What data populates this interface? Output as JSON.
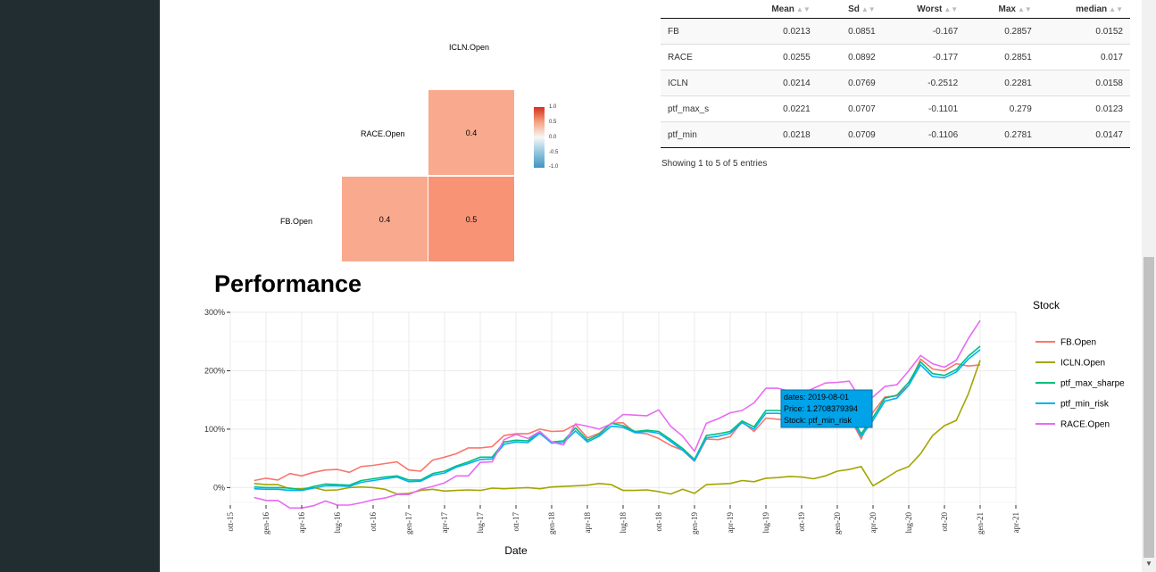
{
  "correlation": {
    "row_labels": [
      "ICLN.Open",
      "RACE.Open",
      "FB.Open"
    ],
    "cells": [
      {
        "row": "RACE.Open",
        "col": "ICLN.Open",
        "value": "0.4",
        "color": "#f9a98e"
      },
      {
        "row": "FB.Open",
        "col": "RACE.Open",
        "value": "0.4",
        "color": "#f9a98e"
      },
      {
        "row": "FB.Open",
        "col": "ICLN.Open",
        "value": "0.5",
        "color": "#f99376"
      }
    ],
    "legend_ticks": [
      "1.0",
      "0.5",
      "0.0",
      "-0.5",
      "-1.0"
    ]
  },
  "stats_table": {
    "headers": [
      "",
      "Mean",
      "Sd",
      "Worst",
      "Max",
      "median"
    ],
    "rows": [
      [
        "FB",
        "0.0213",
        "0.0851",
        "-0.167",
        "0.2857",
        "0.0152"
      ],
      [
        "RACE",
        "0.0255",
        "0.0892",
        "-0.177",
        "0.2851",
        "0.017"
      ],
      [
        "ICLN",
        "0.0214",
        "0.0769",
        "-0.2512",
        "0.2281",
        "0.0158"
      ],
      [
        "ptf_max_s",
        "0.0221",
        "0.0707",
        "-0.1101",
        "0.279",
        "0.0123"
      ],
      [
        "ptf_min",
        "0.0218",
        "0.0709",
        "-0.1106",
        "0.2781",
        "0.0147"
      ]
    ],
    "info": "Showing 1 to 5 of 5 entries"
  },
  "performance": {
    "title": "Performance",
    "tooltip": {
      "line1": "dates: 2019-08-01",
      "line2": "Price:  1.2708379394",
      "line3": "Stock: ptf_min_risk"
    }
  },
  "chart_data": {
    "type": "line",
    "xlabel": "Date",
    "ylabel": "",
    "legend_title": "Stock",
    "ylim": [
      -0.3,
      3.0
    ],
    "yticks": [
      "300%",
      "200%",
      "100%",
      "0%"
    ],
    "xticks": [
      "ott-15",
      "gen-16",
      "apr-16",
      "lug-16",
      "ott-16",
      "gen-17",
      "apr-17",
      "lug-17",
      "ott-17",
      "gen-18",
      "apr-18",
      "lug-18",
      "ott-18",
      "gen-19",
      "apr-19",
      "lug-19",
      "ott-19",
      "gen-20",
      "apr-20",
      "lug-20",
      "ott-20",
      "gen-21",
      "apr-21"
    ],
    "x": [
      "2015-12",
      "2016-01",
      "2016-02",
      "2016-03",
      "2016-04",
      "2016-05",
      "2016-06",
      "2016-07",
      "2016-08",
      "2016-09",
      "2016-10",
      "2016-11",
      "2016-12",
      "2017-01",
      "2017-02",
      "2017-03",
      "2017-04",
      "2017-05",
      "2017-06",
      "2017-07",
      "2017-08",
      "2017-09",
      "2017-10",
      "2017-11",
      "2017-12",
      "2018-01",
      "2018-02",
      "2018-03",
      "2018-04",
      "2018-05",
      "2018-06",
      "2018-07",
      "2018-08",
      "2018-09",
      "2018-10",
      "2018-11",
      "2018-12",
      "2019-01",
      "2019-02",
      "2019-03",
      "2019-04",
      "2019-05",
      "2019-06",
      "2019-07",
      "2019-08",
      "2019-09",
      "2019-10",
      "2019-11",
      "2019-12",
      "2020-01",
      "2020-02",
      "2020-03",
      "2020-04",
      "2020-05",
      "2020-06",
      "2020-07",
      "2020-08",
      "2020-09",
      "2020-10",
      "2020-11",
      "2020-12",
      "2021-01"
    ],
    "series": [
      {
        "name": "FB.Open",
        "color": "#f8766d",
        "values": [
          0.12,
          0.16,
          0.13,
          0.24,
          0.2,
          0.26,
          0.3,
          0.31,
          0.26,
          0.36,
          0.38,
          0.41,
          0.44,
          0.3,
          0.28,
          0.47,
          0.52,
          0.58,
          0.68,
          0.68,
          0.7,
          0.89,
          0.92,
          0.92,
          1.0,
          0.96,
          0.97,
          1.08,
          0.85,
          0.93,
          1.1,
          1.11,
          0.94,
          0.92,
          0.84,
          0.72,
          0.64,
          0.45,
          0.83,
          0.82,
          0.87,
          1.13,
          0.96,
          1.19,
          1.17,
          1.15,
          1.13,
          1.18,
          1.34,
          1.43,
          1.22,
          0.83,
          1.29,
          1.55,
          1.57,
          1.75,
          2.2,
          2.03,
          2.0,
          2.12,
          2.08,
          2.1
        ]
      },
      {
        "name": "ICLN.Open",
        "color": "#a3a500",
        "values": [
          0.07,
          0.05,
          0.05,
          -0.02,
          -0.02,
          0.0,
          -0.05,
          -0.04,
          0.0,
          0.01,
          0.0,
          -0.03,
          -0.11,
          -0.1,
          -0.05,
          -0.03,
          -0.06,
          -0.05,
          -0.04,
          -0.05,
          -0.01,
          -0.02,
          -0.01,
          0.0,
          -0.02,
          0.01,
          0.02,
          0.03,
          0.04,
          0.07,
          0.05,
          -0.05,
          -0.05,
          -0.04,
          -0.07,
          -0.11,
          -0.03,
          -0.1,
          0.05,
          0.06,
          0.07,
          0.12,
          0.1,
          0.16,
          0.17,
          0.19,
          0.18,
          0.15,
          0.2,
          0.28,
          0.31,
          0.36,
          0.03,
          0.15,
          0.28,
          0.36,
          0.58,
          0.89,
          1.06,
          1.15,
          1.6,
          2.18
        ]
      },
      {
        "name": "ptf_max_sharpe",
        "color": "#00bf7d",
        "values": [
          0.01,
          0.0,
          0.0,
          -0.01,
          -0.04,
          0.02,
          0.06,
          0.05,
          0.04,
          0.12,
          0.15,
          0.18,
          0.2,
          0.13,
          0.13,
          0.24,
          0.28,
          0.37,
          0.44,
          0.52,
          0.52,
          0.78,
          0.81,
          0.8,
          0.96,
          0.78,
          0.8,
          1.02,
          0.81,
          0.91,
          1.1,
          1.06,
          0.96,
          0.98,
          0.96,
          0.82,
          0.67,
          0.48,
          0.89,
          0.92,
          0.96,
          1.14,
          1.04,
          1.32,
          1.32,
          1.3,
          1.18,
          1.2,
          1.35,
          1.42,
          1.28,
          0.92,
          1.2,
          1.53,
          1.58,
          1.8,
          2.15,
          1.95,
          1.92,
          2.02,
          2.25,
          2.42
        ]
      },
      {
        "name": "ptf_min_risk",
        "color": "#00b0f6",
        "values": [
          -0.02,
          -0.03,
          -0.03,
          -0.05,
          -0.05,
          -0.01,
          0.03,
          0.03,
          0.02,
          0.09,
          0.12,
          0.15,
          0.18,
          0.1,
          0.11,
          0.21,
          0.25,
          0.35,
          0.41,
          0.48,
          0.49,
          0.74,
          0.78,
          0.77,
          0.93,
          0.76,
          0.77,
          0.97,
          0.78,
          0.88,
          1.05,
          1.03,
          0.94,
          0.96,
          0.93,
          0.79,
          0.64,
          0.46,
          0.85,
          0.88,
          0.93,
          1.11,
          1.0,
          1.27,
          1.27,
          1.25,
          1.14,
          1.16,
          1.3,
          1.38,
          1.24,
          0.88,
          1.15,
          1.48,
          1.53,
          1.75,
          2.1,
          1.9,
          1.88,
          1.98,
          2.2,
          2.36
        ]
      },
      {
        "name": "RACE.Open",
        "color": "#e76bf3",
        "values": [
          -0.17,
          -0.22,
          -0.22,
          -0.35,
          -0.35,
          -0.31,
          -0.23,
          -0.3,
          -0.3,
          -0.26,
          -0.21,
          -0.18,
          -0.12,
          -0.12,
          -0.03,
          0.02,
          0.08,
          0.2,
          0.2,
          0.43,
          0.44,
          0.82,
          0.91,
          0.84,
          0.96,
          0.78,
          0.73,
          1.09,
          1.05,
          1.0,
          1.09,
          1.25,
          1.24,
          1.23,
          1.33,
          1.05,
          0.88,
          0.62,
          1.1,
          1.18,
          1.28,
          1.32,
          1.45,
          1.7,
          1.7,
          1.65,
          1.6,
          1.7,
          1.79,
          1.8,
          1.82,
          1.5,
          1.55,
          1.73,
          1.76,
          2.0,
          2.26,
          2.12,
          2.06,
          2.18,
          2.55,
          2.86
        ]
      }
    ]
  }
}
